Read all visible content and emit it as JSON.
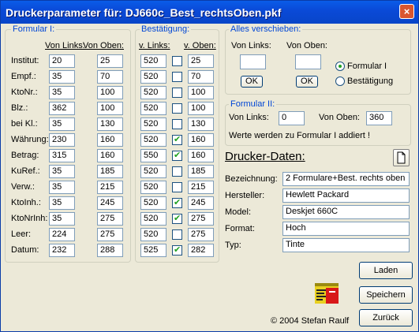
{
  "window": {
    "title": "Druckerparameter für: DJ660c_Best_rechtsOben.pkf",
    "close_glyph": "×"
  },
  "formular1": {
    "legend": "Formular I:",
    "col_links": "Von Links:",
    "col_oben": "Von Oben:",
    "rows": [
      {
        "label": "Institut:",
        "links": "20",
        "oben": "25"
      },
      {
        "label": "Empf.:",
        "links": "35",
        "oben": "70"
      },
      {
        "label": "KtoNr.:",
        "links": "35",
        "oben": "100"
      },
      {
        "label": "Blz.:",
        "links": "362",
        "oben": "100"
      },
      {
        "label": "bei Kl.:",
        "links": "35",
        "oben": "130"
      },
      {
        "label": "Währung:",
        "links": "230",
        "oben": "160"
      },
      {
        "label": "Betrag:",
        "links": "315",
        "oben": "160"
      },
      {
        "label": "KuRef.:",
        "links": "35",
        "oben": "185"
      },
      {
        "label": "Verw.:",
        "links": "35",
        "oben": "215"
      },
      {
        "label": "KtoInh.:",
        "links": "35",
        "oben": "245"
      },
      {
        "label": "KtoNrInh:",
        "links": "35",
        "oben": "275"
      },
      {
        "label": "Leer:",
        "links": "224",
        "oben": "275"
      },
      {
        "label": "Datum:",
        "links": "232",
        "oben": "288"
      }
    ]
  },
  "bestaetigung": {
    "legend": "Bestätigung:",
    "col_links": "v. Links:",
    "col_oben": "v. Oben:",
    "rows": [
      {
        "links": "520",
        "checked": false,
        "oben": "25"
      },
      {
        "links": "520",
        "checked": false,
        "oben": "70"
      },
      {
        "links": "520",
        "checked": false,
        "oben": "100"
      },
      {
        "links": "520",
        "checked": false,
        "oben": "100"
      },
      {
        "links": "520",
        "checked": false,
        "oben": "130"
      },
      {
        "links": "520",
        "checked": true,
        "oben": "160"
      },
      {
        "links": "550",
        "checked": true,
        "oben": "160"
      },
      {
        "links": "520",
        "checked": false,
        "oben": "185"
      },
      {
        "links": "520",
        "checked": false,
        "oben": "215"
      },
      {
        "links": "520",
        "checked": true,
        "oben": "245"
      },
      {
        "links": "520",
        "checked": true,
        "oben": "275"
      },
      {
        "links": "520",
        "checked": false,
        "oben": "275"
      },
      {
        "links": "525",
        "checked": true,
        "oben": "282"
      }
    ]
  },
  "verschieben": {
    "legend": "Alles verschieben:",
    "links_label": "Von Links:",
    "oben_label": "Von Oben:",
    "links_value": "",
    "oben_value": "",
    "ok1": "OK",
    "ok2": "OK",
    "radio_formular": "Formular I",
    "radio_bestaetigung": "Bestätigung",
    "selected": "formular"
  },
  "formular2": {
    "legend": "Formular II:",
    "links_label": "Von Links:",
    "links_value": "0",
    "oben_label": "Von Oben:",
    "oben_value": "360",
    "note": "Werte werden zu Formular I addiert !"
  },
  "drucker": {
    "heading": "Drucker-Daten:",
    "fields": [
      {
        "label": "Bezeichnung:",
        "value": "2 Formulare+Best. rechts oben"
      },
      {
        "label": "Hersteller:",
        "value": "Hewlett Packard"
      },
      {
        "label": "Model:",
        "value": "Deskjet 660C"
      },
      {
        "label": "Format:",
        "value": "Hoch"
      },
      {
        "label": "Typ:",
        "value": "Tinte"
      }
    ]
  },
  "buttons": {
    "laden": "Laden",
    "speichern": "Speichern",
    "zurueck": "Zurück"
  },
  "copyright": "© 2004 Stefan Raulf",
  "icons": {
    "document": "document-icon",
    "logo": "app-logo-icon"
  },
  "colors": {
    "title_bar": "#0a4ad8",
    "group_legend": "#0046d5",
    "check": "#21a121"
  }
}
